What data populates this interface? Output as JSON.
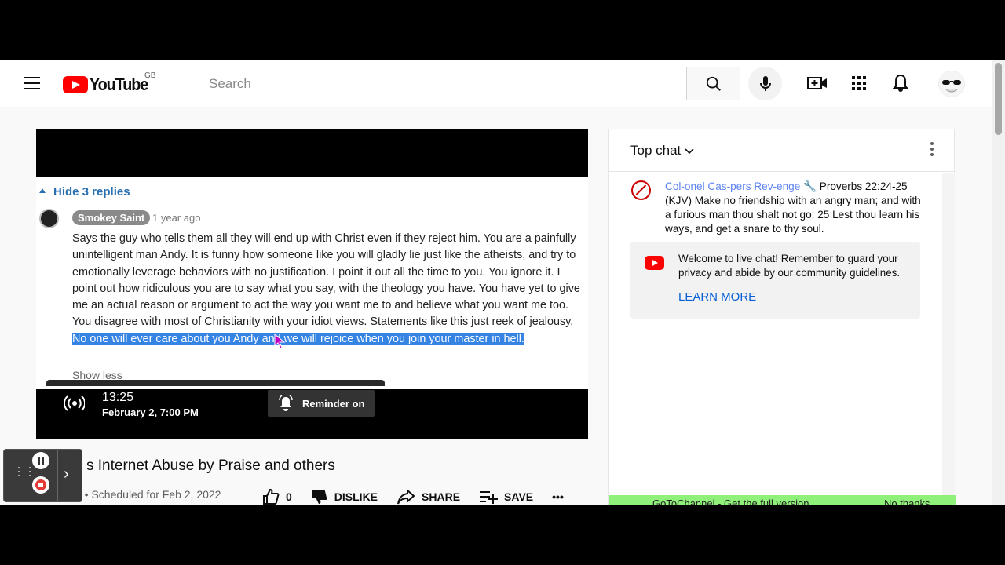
{
  "masthead": {
    "logo_text": "YouTube",
    "region": "GB",
    "search_placeholder": "Search"
  },
  "player": {
    "comment_thread": {
      "toggle_label": "Hide 3 replies",
      "author": "Smokey Saint",
      "time": "1 year ago",
      "body_plain": "Says the guy who tells them all they will end up with Christ even if they reject him. You are a painfully unintelligent man Andy. It is funny how someone like you will gladly lie just like the atheists, and try to emotionally leverage behaviors with no justification. I point it out all the time to you. You ignore it. I point out how ridiculous you are to say what you say, with the theology you have. You have yet to give me an actual reason or argument to act the way you want me to and believe what you want me too. You disagree with most of Christianity with your idiot views. Statements like this just reek of jealousy.",
      "body_highlighted": " No one will ever care about you Andy and we will rejoice when you join your master in hell.",
      "show_less": "Show less"
    },
    "schedule": {
      "time": "13:25",
      "date": "February 2, 7:00 PM",
      "reminder_label": "Reminder on"
    }
  },
  "video": {
    "title": "s Internet Abuse by Praise and others",
    "meta": "g • Scheduled for Feb 2, 2022",
    "likes": "0",
    "dislike_label": "DISLIKE",
    "share_label": "SHARE",
    "save_label": "SAVE",
    "more_label": "•••"
  },
  "chat": {
    "title": "Top chat",
    "message": {
      "author": "Col-onel Cas-pers Rev-enge",
      "text": "Proverbs 22:24-25 (KJV) Make no friendship with an angry man; and with a furious man thou shalt not go: 25 Lest thou learn his ways, and get a snare to thy soul."
    },
    "welcome_text": "Welcome to live chat! Remember to guard your privacy and abide by our community guidelines.",
    "learn_more": "LEARN MORE",
    "promo_left": "GoToChannel - Get the full version",
    "promo_right": "No thanks"
  },
  "colors": {
    "brand_red": "#ff0000",
    "link_blue": "#065fd4",
    "highlight": "#3584e4",
    "promo_green": "#8ff07a"
  }
}
